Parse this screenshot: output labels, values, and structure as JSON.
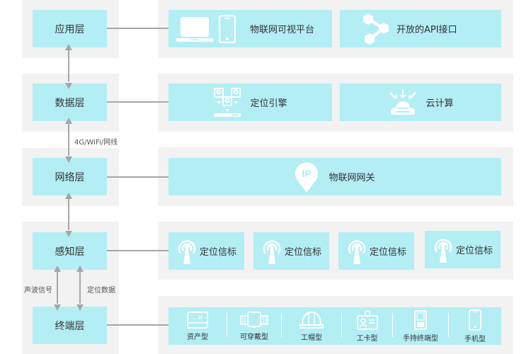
{
  "colors": {
    "panel": "#f2f2f2",
    "box": "#b3eef4",
    "connector": "#a6a6a6",
    "icon": "#ffffff",
    "text": "#333333"
  },
  "layers": [
    {
      "label": "应用层"
    },
    {
      "label": "数据层"
    },
    {
      "label": "网络层"
    },
    {
      "label": "感知层"
    },
    {
      "label": "终端层"
    }
  ],
  "arrows": {
    "data_network": "4G/WiFi/网线",
    "sound_signal": "声波信号",
    "location_data": "定位数据"
  },
  "application": {
    "items": [
      {
        "label": "物联网可视平台",
        "icons": [
          "laptop-icon",
          "smartphone-icon"
        ]
      },
      {
        "label": "开放的API接口",
        "icon": "share-nodes-icon"
      }
    ]
  },
  "data": {
    "items": [
      {
        "label": "定位引擎",
        "icon": "positioning-engine-icon"
      },
      {
        "label": "云计算",
        "icon": "cloud-computing-icon"
      }
    ]
  },
  "network": {
    "items": [
      {
        "label": "物联网网关",
        "icon": "ip-pin-icon",
        "icon_text": "IP"
      }
    ]
  },
  "perception": {
    "items": [
      {
        "label": "定位信标",
        "icon": "beacon-antenna-icon"
      },
      {
        "label": "定位信标",
        "icon": "beacon-antenna-icon"
      },
      {
        "label": "定位信标",
        "icon": "beacon-antenna-icon"
      },
      {
        "label": "定位信标",
        "icon": "beacon-antenna-icon"
      }
    ]
  },
  "terminal": {
    "items": [
      {
        "label": "资产型",
        "icon": "asset-tag-icon",
        "icon_text": "... ///"
      },
      {
        "label": "可穿戴型",
        "icon": "wristband-icon"
      },
      {
        "label": "工帽型",
        "icon": "helmet-icon"
      },
      {
        "label": "工卡型",
        "icon": "badge-card-icon"
      },
      {
        "label": "手持终端型",
        "icon": "handheld-terminal-icon"
      },
      {
        "label": "手机型",
        "icon": "mobile-phone-icon"
      }
    ]
  }
}
